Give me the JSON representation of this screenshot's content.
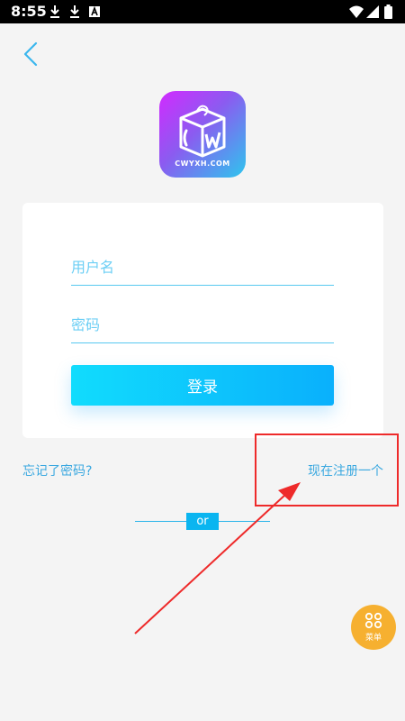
{
  "status_bar": {
    "time": "8:55",
    "notification_icons": [
      "download-icon",
      "download-icon",
      "a-icon"
    ],
    "system_icons": [
      "wifi-icon",
      "signal-icon",
      "battery-icon"
    ]
  },
  "logo": {
    "text": "CWYXH.COM"
  },
  "login_form": {
    "username_placeholder": "用户名",
    "password_placeholder": "密码",
    "login_label": "登录"
  },
  "links": {
    "forgot_password": "忘记了密码?",
    "register": "现在注册一个"
  },
  "divider": {
    "label": "or"
  },
  "menu_fab": {
    "label": "菜单"
  },
  "colors": {
    "accent": "#0ab0fc",
    "link": "#3aa8e0",
    "annotation_red": "#ee2a2a",
    "fab": "#f6b030"
  }
}
